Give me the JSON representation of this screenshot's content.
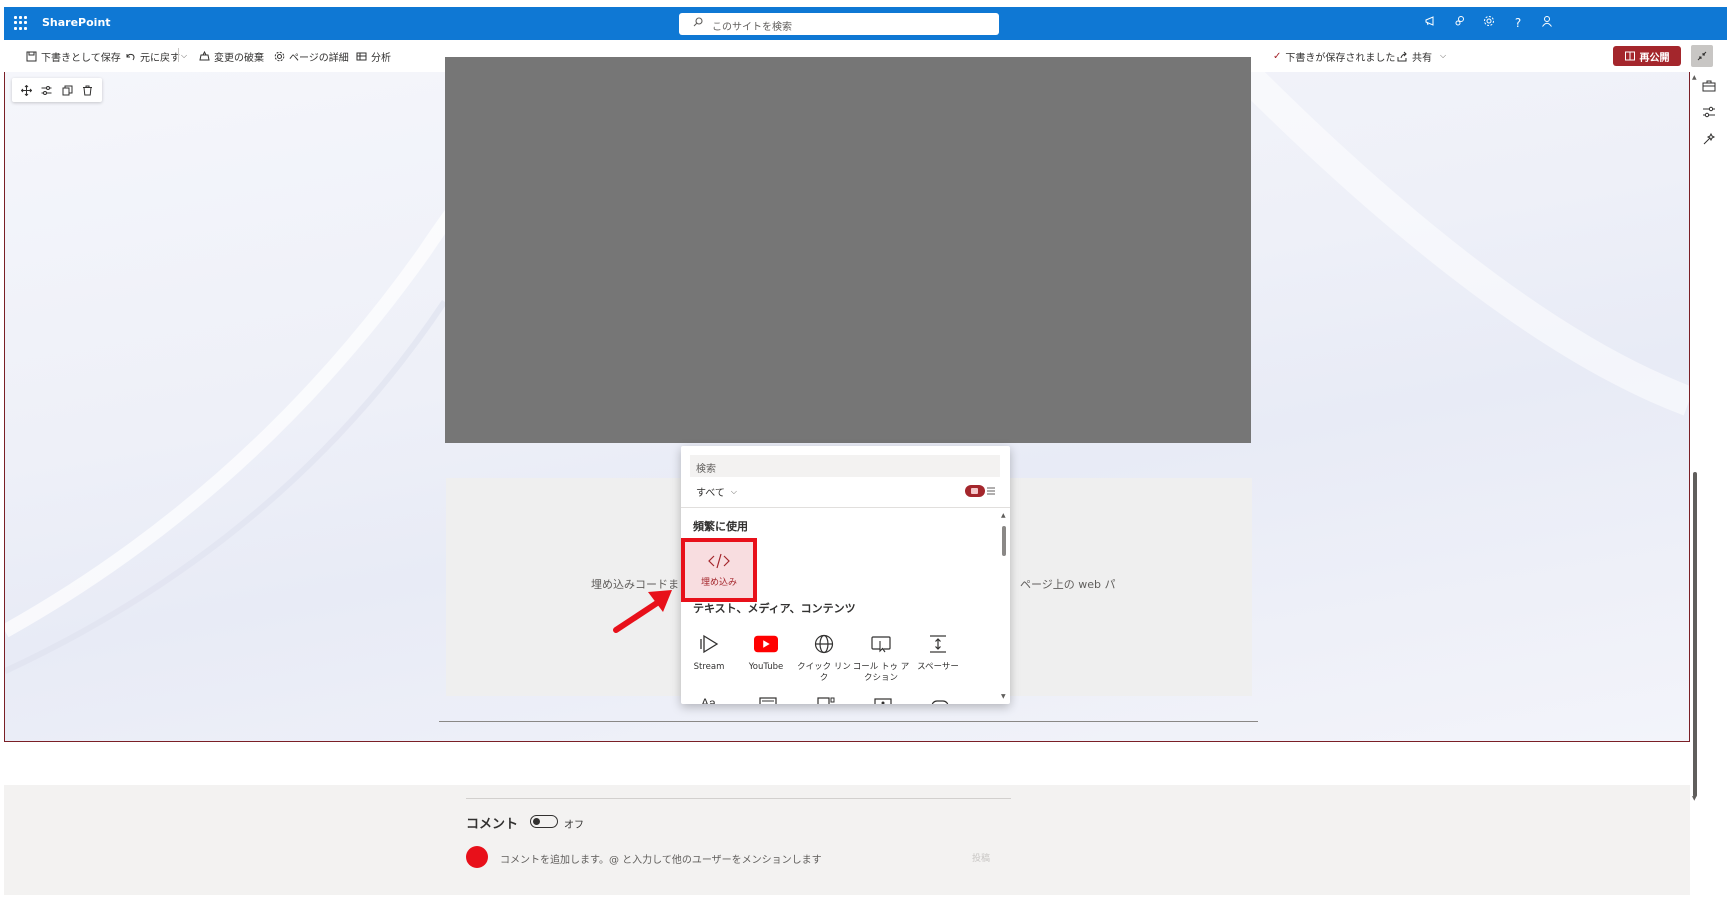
{
  "suitebar": {
    "app_name": "SharePoint",
    "search_placeholder": "このサイトを検索"
  },
  "commandbar": {
    "save_draft": "下書きとして保存",
    "undo": "元に戻す",
    "discard": "変更の破棄",
    "page_details": "ページの詳細",
    "analytics": "分析",
    "saved_status": "下書きが保存されました",
    "share": "共有",
    "republish": "再公開"
  },
  "embed_zone": {
    "hint_left": "埋め込みコードま",
    "hint_right": "ページ上の web パ"
  },
  "picker": {
    "search_placeholder": "検索",
    "filter": "すべて",
    "frequent_heading": "頻繁に使用",
    "embed_label": "埋め込み",
    "text_media_heading": "テキスト、メディア、コンテンツ",
    "items": [
      {
        "label": "Stream",
        "icon": "stream-icon"
      },
      {
        "label": "YouTube",
        "icon": "youtube-icon"
      },
      {
        "label": "クイック リン\nク",
        "icon": "globe-icon"
      },
      {
        "label": "コール トゥ ア\nクション",
        "icon": "call-to-action-icon"
      },
      {
        "label": "スペーサー",
        "icon": "spacer-icon"
      }
    ]
  },
  "comments": {
    "title": "コメント",
    "toggle_state": "オフ",
    "input_placeholder": "コメントを追加します。@ と入力して他のユーザーをメンションします",
    "post_label": "投稿"
  },
  "colors": {
    "suitebar": "#0f78d4",
    "accent": "#a4262c",
    "highlight_box": "#e8101a",
    "video_placeholder": "#767676"
  }
}
